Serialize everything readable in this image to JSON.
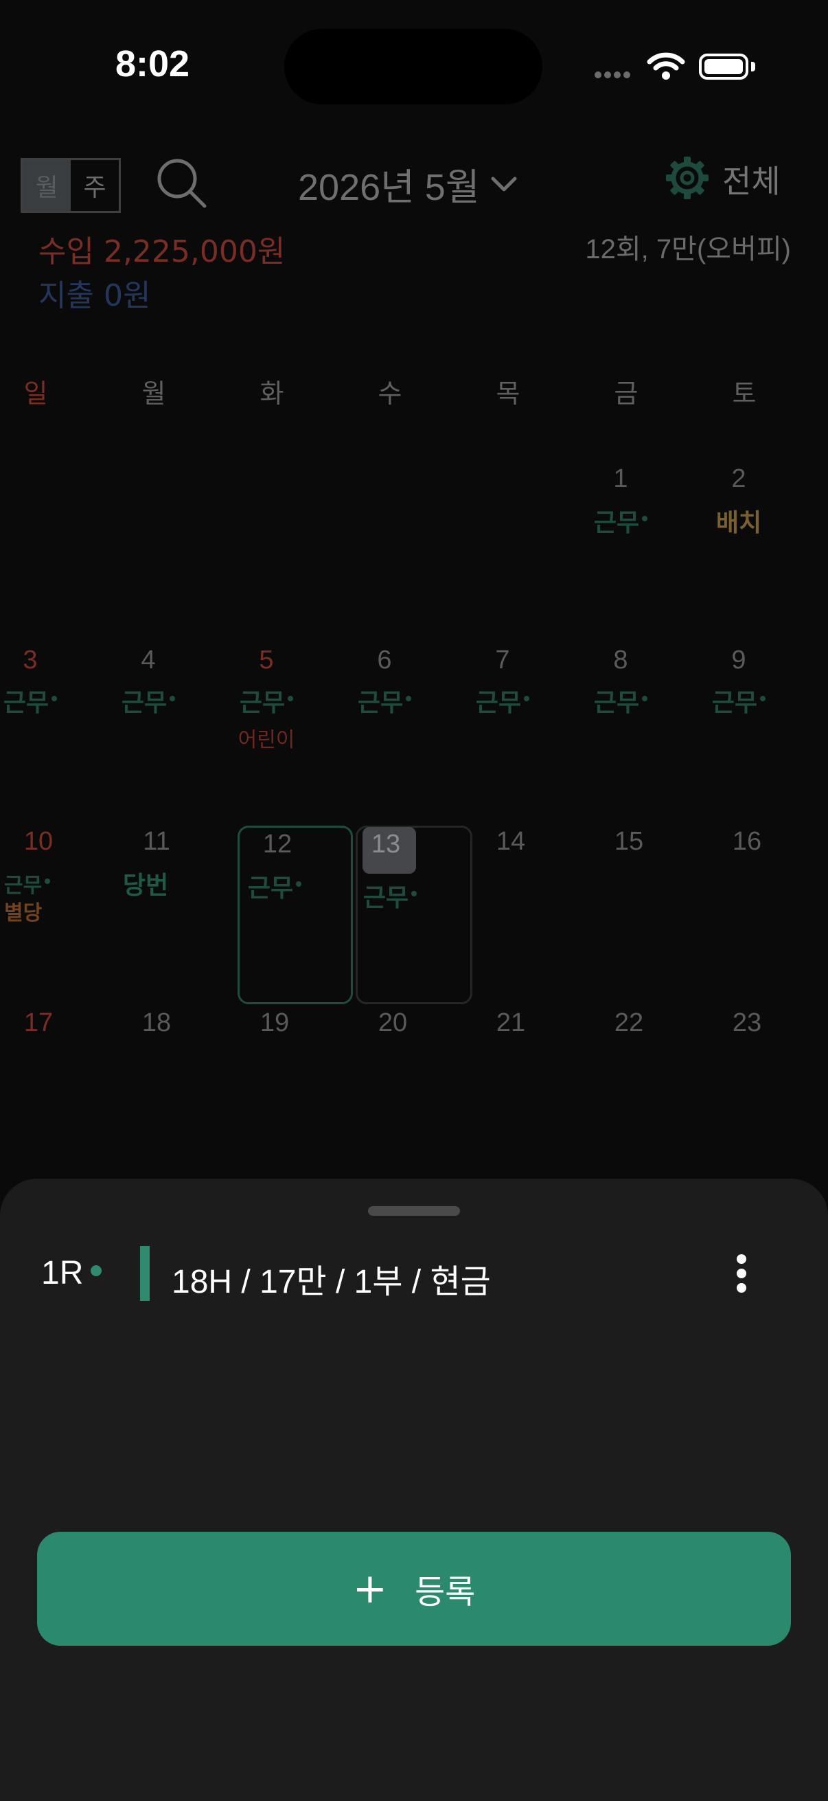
{
  "status_bar": {
    "time": "8:02"
  },
  "header": {
    "view_toggle": [
      "월",
      "주"
    ],
    "month_title": "2026년 5월",
    "filter_label": "전체",
    "income": "수입 2,225,000원",
    "expense": "지출 0원",
    "summary": "12회, 7만(오버피)"
  },
  "weekdays": [
    "일",
    "월",
    "화",
    "수",
    "목",
    "금",
    "토"
  ],
  "days": {
    "d1": "1",
    "d2": "2",
    "d3": "3",
    "d4": "4",
    "d5": "5",
    "d6": "6",
    "d7": "7",
    "d8": "8",
    "d9": "9",
    "d10": "10",
    "d11": "11",
    "d12": "12",
    "d13": "13",
    "d14": "14",
    "d15": "15",
    "d16": "16",
    "d17": "17",
    "d18": "18",
    "d19": "19",
    "d20": "20",
    "d21": "21",
    "d22": "22",
    "d23": "23"
  },
  "tags": {
    "work": "근무",
    "batch": "배치",
    "duty": "당번",
    "special": "별당",
    "holiday_5": "어린이"
  },
  "sheet": {
    "round": "1R",
    "detail": "18H / 17만 / 1부 / 현금",
    "register_plus": "+",
    "register_label": "등록"
  },
  "colors": {
    "accent": "#2b8a6e",
    "sunday": "#7a2d25",
    "income": "#7a2d25",
    "expense": "#23375c"
  }
}
